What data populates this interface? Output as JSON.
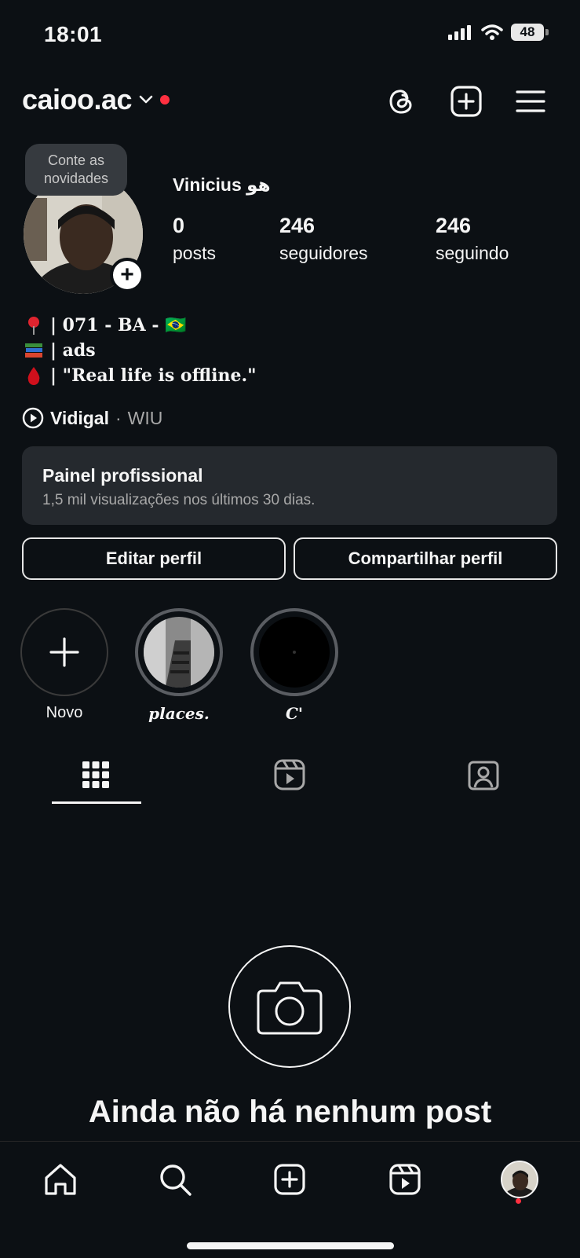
{
  "status": {
    "time": "18:01",
    "battery": "48"
  },
  "header": {
    "username": "caioo.ac"
  },
  "profile": {
    "bubble_text": "Conte as novidades",
    "display_name": "Vinicius هو",
    "stats": [
      {
        "value": "0",
        "label": "posts"
      },
      {
        "value": "246",
        "label": "seguidores"
      },
      {
        "value": "246",
        "label": "seguindo"
      }
    ],
    "bio": [
      {
        "icon": "pin-icon",
        "text": "| 071 - BA - 🇧🇷"
      },
      {
        "icon": "books-icon",
        "text": "| ads"
      },
      {
        "icon": "drop-of-blood-icon",
        "text": "| \"Real life is offline.\""
      }
    ],
    "music": {
      "song": "Vidigal",
      "separator": "·",
      "artist": "WIU"
    }
  },
  "pro_panel": {
    "title": "Painel profissional",
    "subtitle": "1,5 mil visualizações nos últimos 30 dias."
  },
  "buttons": {
    "edit": "Editar perfil",
    "share": "Compartilhar perfil"
  },
  "highlights": [
    {
      "label": "Novo"
    },
    {
      "label": "places."
    },
    {
      "label": "C'"
    }
  ],
  "empty_state": {
    "title": "Ainda não há nenhum post"
  },
  "colors": {
    "background": "#0c1014",
    "panel": "#25292e",
    "notification": "#ff3040"
  }
}
